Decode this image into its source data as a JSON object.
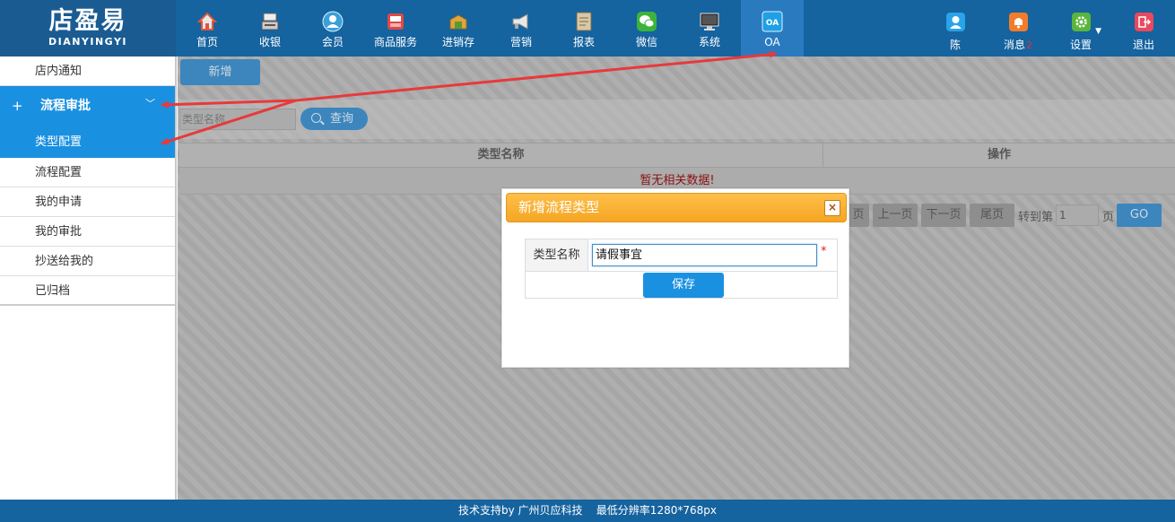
{
  "logo": {
    "cn": "店盈易",
    "en": "DIANYINGYI"
  },
  "nav": [
    {
      "label": "首页",
      "icon": "home-icon",
      "color": "#e2553a"
    },
    {
      "label": "收银",
      "icon": "cash-register-icon",
      "color": "#d8d8d8"
    },
    {
      "label": "会员",
      "icon": "member-icon",
      "color": "#3aa0d8"
    },
    {
      "label": "商品服务",
      "icon": "goods-icon",
      "color": "#e04848"
    },
    {
      "label": "进销存",
      "icon": "inventory-icon",
      "color": "#e0a440"
    },
    {
      "label": "营销",
      "icon": "megaphone-icon",
      "color": "#d0d0d0"
    },
    {
      "label": "报表",
      "icon": "report-icon",
      "color": "#c8b89a"
    },
    {
      "label": "微信",
      "icon": "wechat-icon",
      "color": "#3cb43c"
    },
    {
      "label": "系统",
      "icon": "monitor-icon",
      "color": "#333333"
    },
    {
      "label": "OA",
      "icon": "oa-icon",
      "color": "#1ea0e6",
      "active": true
    }
  ],
  "user_nav": {
    "user": {
      "label": "陈",
      "icon": "user-icon",
      "color": "#29a3ea"
    },
    "messages": {
      "label": "消息",
      "badge": "2",
      "icon": "bell-icon",
      "color": "#f27c2a"
    },
    "settings": {
      "label": "设置",
      "icon": "gear-icon",
      "color": "#5ab53c"
    },
    "logout": {
      "label": "退出",
      "icon": "logout-icon",
      "color": "#e8495e"
    }
  },
  "sidebar": {
    "top_item": "店内通知",
    "group": {
      "label": "流程审批",
      "icon": "+",
      "chevron": "﹀"
    },
    "items": [
      "类型配置",
      "流程配置",
      "我的申请",
      "我的审批",
      "抄送给我的",
      "已归档"
    ],
    "active_index": 0
  },
  "toolbar": {
    "new_label": "新增",
    "search_placeholder": "类型名称",
    "query_label": "查询"
  },
  "table": {
    "columns": [
      "类型名称",
      "操作"
    ],
    "empty_text": "暂无相关数据!"
  },
  "pager": {
    "first_partial": "页",
    "prev": "上一页",
    "next": "下一页",
    "last": "尾页",
    "goto_label": "转到第",
    "page_value": "1",
    "page_suffix": "页",
    "go": "GO"
  },
  "dialog": {
    "title": "新增流程类型",
    "close": "×",
    "field_label": "类型名称",
    "field_value": "请假事宜",
    "required_mark": "*",
    "save_label": "保存"
  },
  "footer": {
    "text": "技术支持by 广州贝应科技    最低分辨率1280*768px"
  },
  "colors": {
    "topbar": "#15639f",
    "accent": "#1a90e0",
    "dialog_header": "#f5a623",
    "annotation_arrow": "#e8393b"
  }
}
